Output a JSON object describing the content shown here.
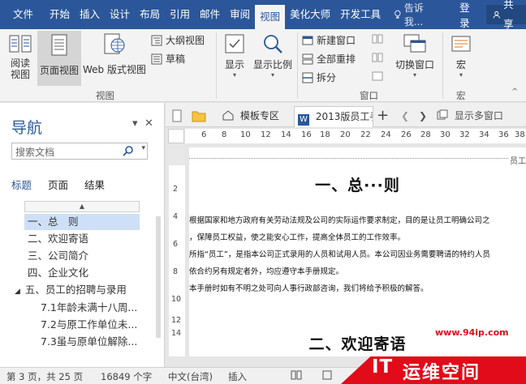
{
  "ribbon_tabs": [
    "文件",
    "开始",
    "插入",
    "设计",
    "布局",
    "引用",
    "邮件",
    "审阅",
    "视图",
    "美化大师",
    "开发工具"
  ],
  "active_tab": "视图",
  "tell_me": "告诉我...",
  "login": "登录",
  "share": "共享",
  "views_group": {
    "read_mode": "阅读\n视图",
    "print_layout": "页面视图",
    "web_layout": "Web 版式视图",
    "outline": "大纲视图",
    "draft": "草稿",
    "label": "视图"
  },
  "show_group": {
    "show": "显示",
    "zoom": "显示比例"
  },
  "window_group": {
    "new_window": "新建窗口",
    "arrange_all": "全部重排",
    "split": "拆分",
    "switch_windows": "切换窗口",
    "label": "窗口"
  },
  "macros_group": {
    "macro": "宏",
    "label": "宏"
  },
  "nav": {
    "title": "导航",
    "search_placeholder": "搜索文档",
    "tabs": [
      "标题",
      "页面",
      "结果"
    ],
    "items": [
      {
        "text": "一、总　则",
        "selected": true
      },
      {
        "text": "二、欢迎寄语"
      },
      {
        "text": "三、公司简介"
      },
      {
        "text": "四、企业文化"
      },
      {
        "text": "五、员工的招聘与录用"
      },
      {
        "text": "7.1年龄未满十八周..."
      },
      {
        "text": "7.2与原工作单位未..."
      },
      {
        "text": "7.3虽与原单位解除..."
      }
    ]
  },
  "doc_tabs": {
    "template": "模板专区",
    "document": "2013版员工手",
    "show_multi": "显示多窗口"
  },
  "ruler_h": [
    "6",
    "8",
    "10",
    "12",
    "14",
    "16",
    "18",
    "20",
    "22",
    "24",
    "26",
    "28",
    "30",
    "32",
    "34",
    "36",
    "38"
  ],
  "ruler_v": [
    "2",
    "4",
    "6",
    "8",
    "10",
    "12",
    "14"
  ],
  "document": {
    "header_text": "员工",
    "heading1": "一、总···则",
    "paragraphs": [
      "根据国家和地方政府有关劳动法规及公司的实际运作要求制定，目的是让员工明确公司之",
      "，保障员工权益，使之能安心工作，提高全体员工的工作效率。",
      "所指“员工”，是指本公司正式录用的人员和试用人员。本公司因业务需要聘请的特约人员",
      "依合约另有规定者外，均应遵守本手册规定。",
      "本手册时如有不明之处可向人事行政部咨询，我们将给予积极的解答。"
    ],
    "heading2": "二、欢迎寄语"
  },
  "status": {
    "page": "第 3 页，共 25 页",
    "words": "16849 个字",
    "lang": "中文(台湾)",
    "mode": "插入"
  },
  "watermark": {
    "url": "www.94ip.com",
    "brand_it": "IT",
    "brand_cn": "运维空间"
  },
  "colors": {
    "accent": "#2b579a",
    "watermark": "#e10b1a"
  }
}
